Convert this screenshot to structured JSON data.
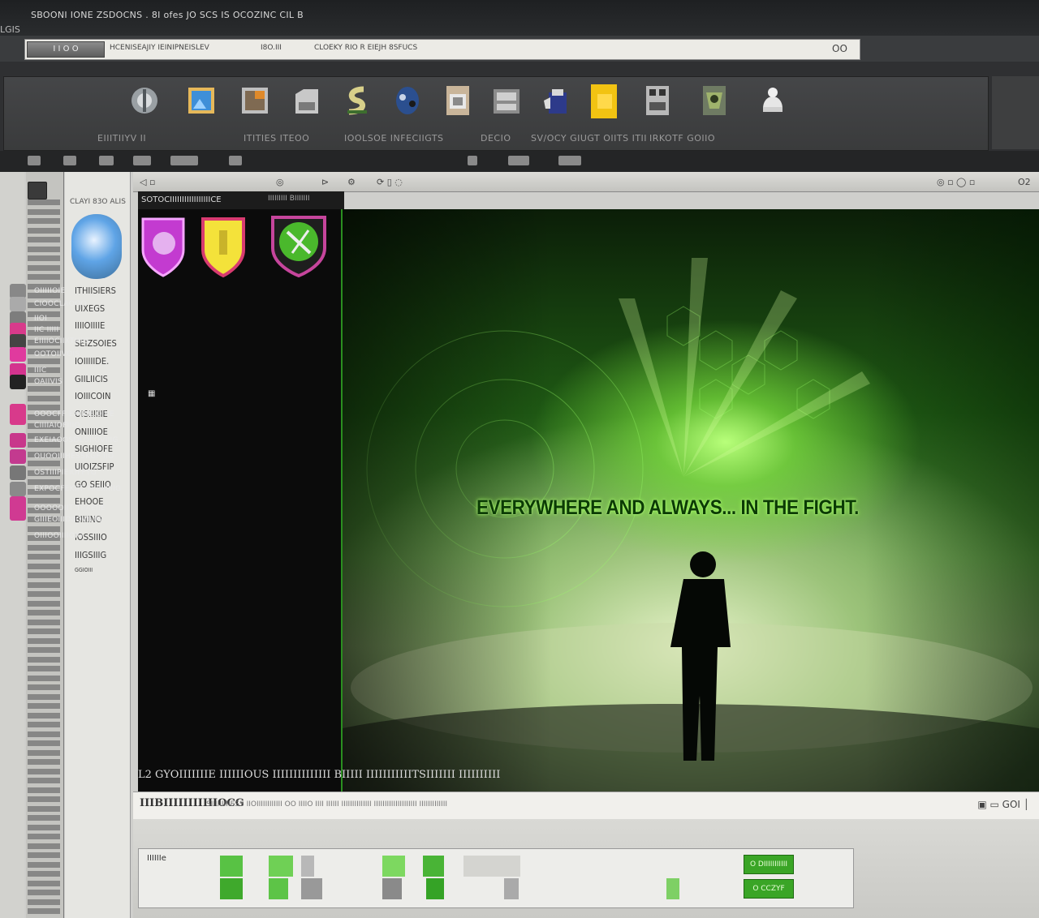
{
  "window": {
    "title": "SBOONI IONE  ZSDOCNS . 8I ofes  JO SCS IS OCOZINC CIL B",
    "subtitle": "LGIS"
  },
  "address_bar": {
    "button_label": "I  I  O  O",
    "text1": "HCENISEAJIY IEINIPNEISLEV",
    "text2": "I8O.III",
    "text3": "CLOEKY RIO  R EIEJH 8SFUCS",
    "end_label": "OO"
  },
  "toolbar": {
    "icons": [
      "ae-icon",
      "image-icon",
      "photo-icon",
      "folder-icon",
      "serpent-icon",
      "mask-icon",
      "slide-icon",
      "window-icon",
      "cup-icon",
      "yellow-box-icon",
      "grid-icon",
      "crest-icon",
      "bell-icon"
    ],
    "labels": [
      "EIIITIIYV  II",
      "ITITIES  ITEOO",
      "IOOLSOE  INFECIIGTS",
      "DECIO",
      "SV/OCY GIUGT  OIITS  ITII",
      "IRKOTF GOIIO"
    ]
  },
  "left_panel": {
    "header": "CLAYI  83O  ALIS",
    "items": [
      "ITHIISIERS",
      "UIXEGS",
      "IIIIOIIIIE",
      "SEIZSOIES",
      "IOIIIIIDE.",
      "GIILIICIS",
      "IOIIICOIN",
      "OISIIIIIIE",
      "ONIIIIOE",
      "SIGHIOFE",
      "UIOIZSFIP",
      "GO SEIIO",
      "EHOOE",
      "BIIIINO",
      "IOSSIIIO",
      "IIIGSIIIG",
      "GGIOIII"
    ]
  },
  "viewer": {
    "chrome_right": "O2"
  },
  "dark_sidebar": {
    "header": "SOTOCIIIIIIIIIIIIIIIIICE",
    "header_right": "IIIIIIIII  BIIIIIII",
    "menu": [
      "OIIIIIOIE",
      "CIOOCLAOOO",
      "IIOI",
      "IIC  IIIII",
      "EIIIIOCIIXTHIIS",
      "OOTOIIVOIS",
      "IIIC",
      "OAIIVIS",
      "OOOCFF EXIIIIE.OIVE",
      "CIIIIAIOFIIIO",
      "EXEIAOOSDLOIIOVIIIG",
      "OUOOIIIHESSKGF IIO",
      "OSTIIIPIEIOFFYG",
      "EXPOCFEKIIT TIIEIIIIIIG",
      "OOOOOIIT  TIIAEIIE",
      "GIIIEOIIIDIIOVILIG",
      "OIIIOOIIIIOIG"
    ],
    "caption": "L2  GYOIIIIIIIE  IIIIIIOUS  IIIIIIIIIIIIII   BIIIII   IIIIIIIIIIITSIIIIIII  IIIIIIIIII"
  },
  "hero": {
    "tagline": "EVERYWHERE AND ALWAYS... IN THE FIGHT."
  },
  "status_bar": {
    "left": "IIIBIIIIIIIIIIIOCG",
    "middle": "SIIIIIIIIIESS   IIOIIIIIIIIIIII OO IIIIO  IIII  IIIIII  IIIIIIIIIIIIII IIIIIIIIIIIIIIIIIIII  IIIIIIIIIIIII",
    "right": "GOI"
  },
  "timeline": {
    "label": "IIIIIIe",
    "clips": [
      "O  DIIIIIIIIIII",
      "O  CCZYF"
    ]
  },
  "colors": {
    "accent_green": "#3aa526",
    "hero_glow": "#9dff55",
    "dark_bg": "#0b0b0b"
  }
}
